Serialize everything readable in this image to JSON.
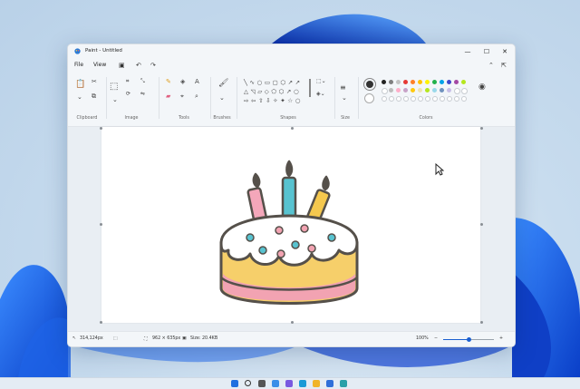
{
  "app": {
    "title": "Paint - Untitled",
    "icon": "paint-app-icon"
  },
  "window_controls": {
    "minimize": "—",
    "maximize": "☐",
    "close": "✕"
  },
  "menu": {
    "file": "File",
    "view": "View"
  },
  "ribbon": {
    "groups": {
      "clipboard": "Clipboard",
      "image": "Image",
      "tools": "Tools",
      "brushes": "Brushes",
      "shapes": "Shapes",
      "size": "Size",
      "colors": "Colors"
    },
    "palette_row1": [
      "#222222",
      "#7f7f7f",
      "#c3c3c3",
      "#e53935",
      "#ff7f27",
      "#ffc107",
      "#fff200",
      "#22b14c",
      "#00a2e8",
      "#3f48cc",
      "#a349a4",
      "#b5e61d"
    ],
    "palette_row2": [
      "#ffffff",
      "#bdbdbd",
      "#ffaec9",
      "#c8a2c8",
      "#ffc90e",
      "#efe4b0",
      "#b5e61d",
      "#99d9ea",
      "#7092be",
      "#c8bfe7",
      "#ffffff",
      "#ffffff"
    ],
    "primary_color": "#333333",
    "secondary_color": "#ffffff"
  },
  "statusbar": {
    "cursor_pos": "314,124px",
    "canvas_size": "962 × 635px",
    "file_size": "Size: 20.4KB",
    "zoom": "100%",
    "zoom_level": 0.5
  },
  "taskbar": {
    "icons": [
      "windows-start-icon",
      "search-icon",
      "task-view-icon",
      "widgets-icon",
      "chat-icon",
      "edge-icon",
      "explorer-icon",
      "store-icon",
      "paint-icon"
    ]
  }
}
